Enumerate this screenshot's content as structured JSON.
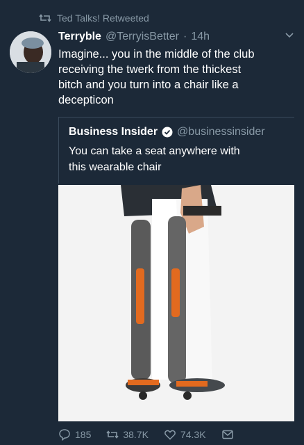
{
  "retweet": {
    "label": "Ted Talks! Retweeted",
    "icon": "retweet-icon"
  },
  "tweet": {
    "name": "Terryble",
    "handle": "@TerryisBetter",
    "separator": "·",
    "time": "14h",
    "text": "Imagine... you in the middle of the club\nreceiving the twerk from the thickest\nbitch and you turn into a chair like a\ndecepticon"
  },
  "quote": {
    "name": "Business Insider",
    "handle": "@businessinsider",
    "text": "You can take a seat anywhere with\nthis wearable chair"
  },
  "actions": {
    "replies": "185",
    "retweets": "38.7K",
    "likes": "74.3K"
  },
  "colors": {
    "background": "#1c2938",
    "muted": "#8899a6",
    "accent_orange": "#e26a1f"
  }
}
